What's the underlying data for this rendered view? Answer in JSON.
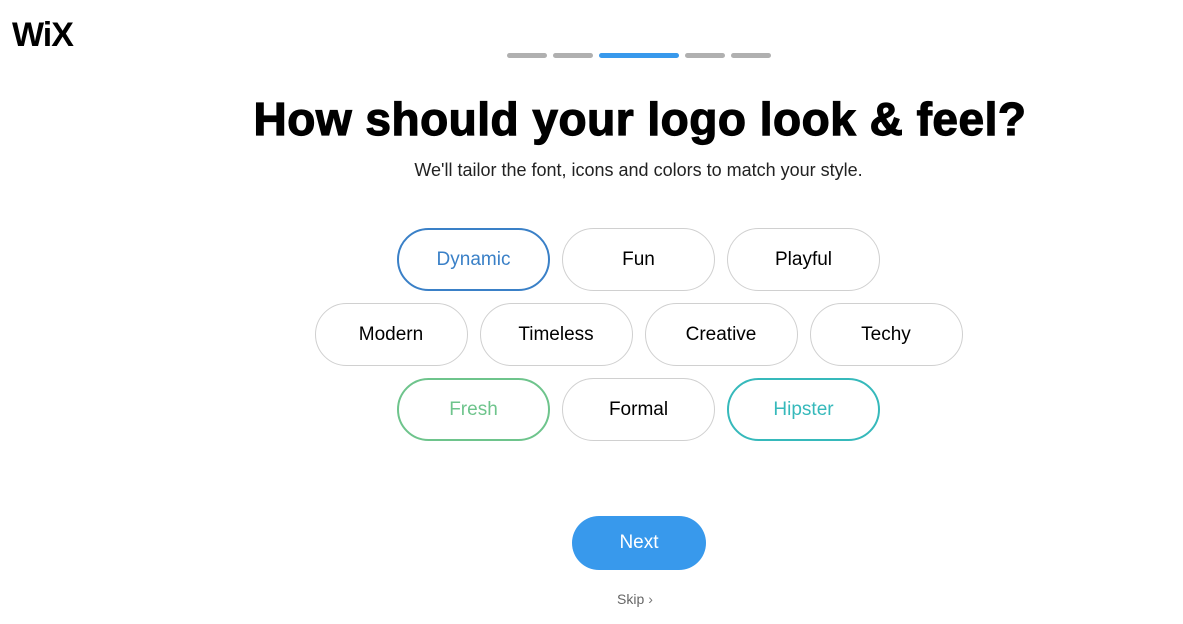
{
  "brand": {
    "logo_text": "WiX"
  },
  "progress": {
    "steps": 5,
    "current_step": 3
  },
  "header": {
    "title": "How should your logo look & feel?",
    "subtitle": "We'll tailor the font, icons and colors to match your style."
  },
  "styles": {
    "rows": [
      [
        {
          "label": "Dynamic",
          "state": "selected",
          "color": "#3a80c7"
        },
        {
          "label": "Fun",
          "state": "default"
        },
        {
          "label": "Playful",
          "state": "default"
        }
      ],
      [
        {
          "label": "Modern",
          "state": "default"
        },
        {
          "label": "Timeless",
          "state": "default"
        },
        {
          "label": "Creative",
          "state": "default"
        },
        {
          "label": "Techy",
          "state": "default"
        }
      ],
      [
        {
          "label": "Fresh",
          "state": "selected",
          "color": "#6ec48c"
        },
        {
          "label": "Formal",
          "state": "default"
        },
        {
          "label": "Hipster",
          "state": "selected",
          "color": "#36b9bb"
        }
      ]
    ]
  },
  "actions": {
    "next_label": "Next",
    "skip_label": "Skip",
    "skip_icon": "chevron-right-icon",
    "accent_color": "#3899ec"
  }
}
